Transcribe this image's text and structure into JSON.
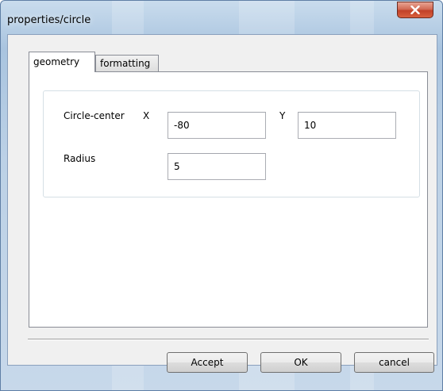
{
  "window": {
    "title": "properties/circle"
  },
  "tabs": [
    {
      "label": "geometry",
      "selected": true
    },
    {
      "label": "formatting",
      "selected": false
    }
  ],
  "geometry": {
    "circle_center_label": "Circle-center",
    "x_label": "X",
    "x_value": "-80",
    "y_label": "Y",
    "y_value": "10",
    "radius_label": "Radius",
    "radius_value": "5"
  },
  "buttons": {
    "accept": "Accept",
    "ok": "OK",
    "cancel": "cancel"
  },
  "icons": {
    "close": "close-icon"
  },
  "colors": {
    "close_button": "#c7432b",
    "title_glass": "#a9c4df"
  }
}
